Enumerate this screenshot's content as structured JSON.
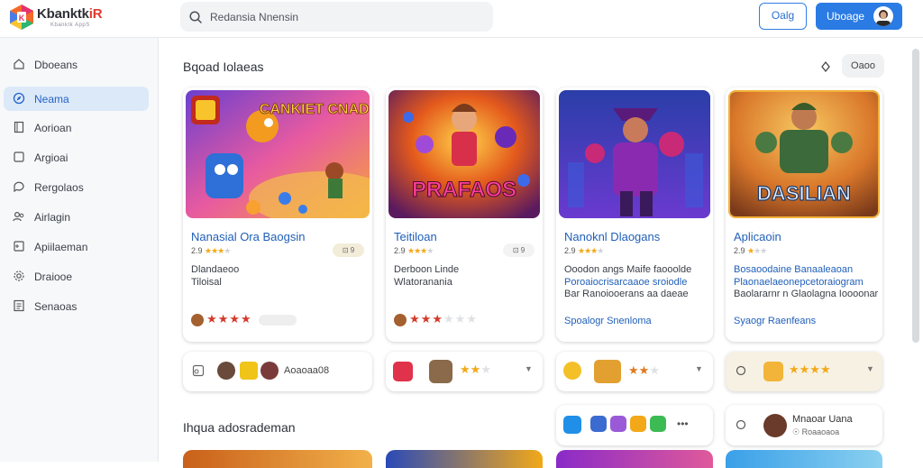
{
  "header": {
    "brand": "Kbanktk",
    "brand_badge": "iR",
    "brand_sub": "Kbanktk AppS",
    "search_placeholder": "Redansia Nnensin",
    "btn_outline": "Oalg",
    "btn_primary": "Uboage"
  },
  "sidebar": {
    "items": [
      {
        "label": "Dboeans",
        "icon": "home-icon"
      },
      {
        "label": "Neama",
        "icon": "compass-icon",
        "active": true
      },
      {
        "label": "Aorioan",
        "icon": "bookmark-icon"
      },
      {
        "label": "Argioai",
        "icon": "grid-icon"
      },
      {
        "label": "Rergolaos",
        "icon": "chat-icon"
      },
      {
        "label": "Airlagin",
        "icon": "people-icon"
      },
      {
        "label": "Apiilaeman",
        "icon": "gamepad-icon"
      },
      {
        "label": "Draiooe",
        "icon": "settings-icon"
      },
      {
        "label": "Senaoas",
        "icon": "docs-icon"
      }
    ]
  },
  "main": {
    "section1_title": "Bqoad Iolaeas",
    "section1_button": "Oaoo",
    "section2_title": "Ihqua adosrademan",
    "cards": [
      {
        "title": "Nanasial Ora Baogsin",
        "rating": "2.9",
        "pill": "⊡ 9",
        "desc1": "Dlandaeoo",
        "desc2": "Tiloisal",
        "art_text": "CANKIET CNADKAN"
      },
      {
        "title": "Teitiloan",
        "rating": "2.9",
        "pill": "⊡ 9",
        "desc1": "Derboon Linde",
        "desc2": "Wlatoranania",
        "art_text": "PRAFAOS"
      },
      {
        "title": "Nanoknl Dlaogans",
        "rating": "2.9",
        "desc1": "Ooodon angs Maife faooolde",
        "desc2": "Poroaiocrisarcaaoe sroiodle",
        "desc3": "Bar Ranoiooerans aa daeae",
        "link": "Spoalogr Snenloma",
        "art_text": ""
      },
      {
        "title": "Aplicaoin",
        "rating": "2.9",
        "desc1": "Bosaoodaine Banaaleaoan",
        "desc2": "Plaonaelaeonepcetoraiogram",
        "desc3": "Baolararnr n Glaolagna Ioooonar",
        "link": "Syaogr Raenfeans",
        "art_text": "DASILIAN"
      }
    ],
    "row2": {
      "card1_label": "Aoaoaa08"
    },
    "row3": {
      "card4_title": "Mnaoar Uana",
      "card4_sub": "☉ Roaaoaoa"
    },
    "colors": {
      "accent": "#2a7be4",
      "link": "#1f5fb8",
      "star": "#f2a818",
      "star_red": "#d43a2b"
    }
  }
}
